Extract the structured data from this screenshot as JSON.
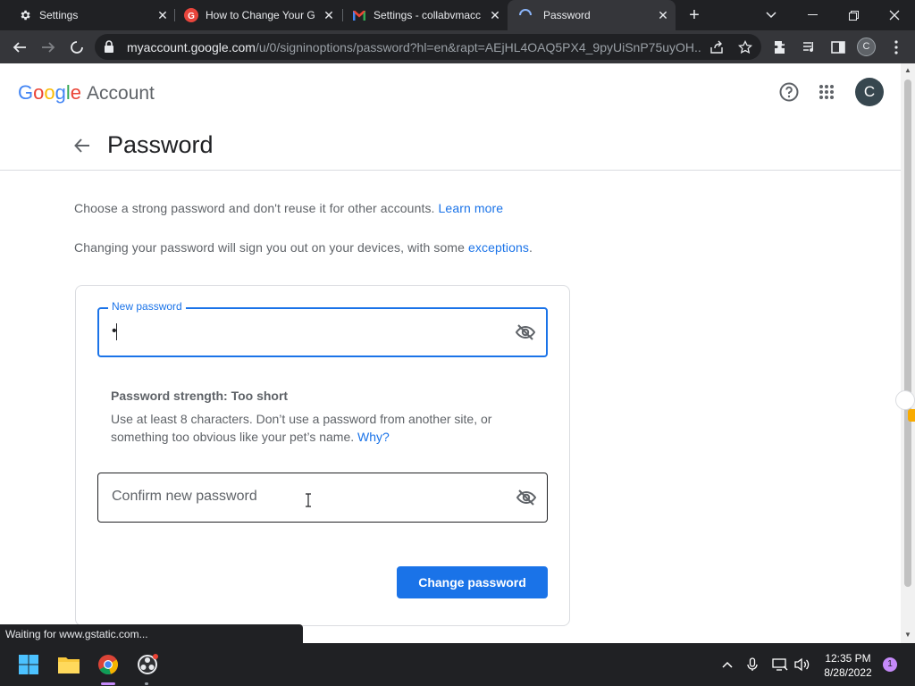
{
  "browser": {
    "tabs": [
      {
        "title": "Settings",
        "favicon": "gear-icon"
      },
      {
        "title": "How to Change Your G",
        "favicon": "red-circle-g-icon"
      },
      {
        "title": "Settings - collabvmacc",
        "favicon": "gmail-icon"
      },
      {
        "title": "Password",
        "favicon": "loading-spinner-icon",
        "active": true
      }
    ],
    "url_host": "myaccount.google.com",
    "url_path": "/u/0/signinoptions/password?hl=en&rapt=AEjHL4OAQ5PX4_9pyUiSnP75uyOH...",
    "profile_initial": "C"
  },
  "header": {
    "logo_letters": [
      "G",
      "o",
      "o",
      "g",
      "l",
      "e"
    ],
    "product": "Account",
    "avatar_initial": "C"
  },
  "page": {
    "title": "Password",
    "intro1_text": "Choose a strong password and don't reuse it for other accounts.",
    "intro1_link": "Learn more",
    "intro2_text": "Changing your password will sign you out on your devices, with some",
    "intro2_link": "exceptions",
    "intro2_end": "."
  },
  "form": {
    "new_password_label": "New password",
    "new_password_value": "•",
    "strength_title": "Password strength: Too short",
    "strength_desc": "Use at least 8 characters. Don’t use a password from another site, or something too obvious like your pet’s name.",
    "strength_link": "Why?",
    "confirm_placeholder": "Confirm new password",
    "submit_label": "Change password"
  },
  "status_bar": "Waiting for www.gstatic.com...",
  "taskbar": {
    "time": "12:35 PM",
    "date": "8/28/2022",
    "notification_count": "1"
  },
  "colors": {
    "accent": "#1a73e8",
    "text": "#202124",
    "secondary_text": "#5f6368",
    "browser_dark": "#202124"
  }
}
